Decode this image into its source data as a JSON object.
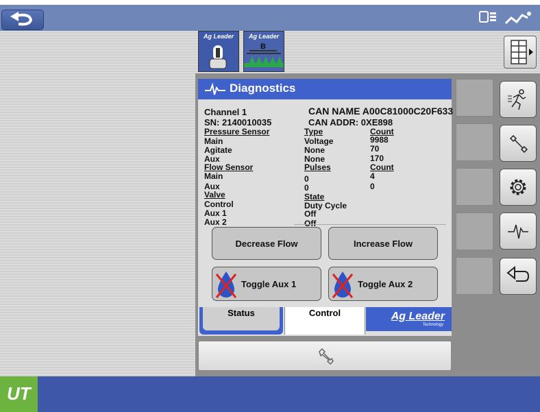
{
  "topbar": {
    "back_icon": "u-turn-back-icon",
    "status_icons": [
      "implement-icon",
      "antenna-icon"
    ]
  },
  "modules": [
    {
      "brand": "Ag Leader",
      "icon": "toggle-switch-icon"
    },
    {
      "brand": "Ag Leader",
      "badge": "B",
      "icon": "sprayer-boom-icon"
    }
  ],
  "menu_button": {
    "icon": "grid-menu-icon"
  },
  "diagnostics": {
    "title": "Diagnostics",
    "channel": "Channel 1",
    "serial": "SN: 2140010035",
    "can_name": "CAN NAME A00C81000C20F633",
    "can_addr": "CAN ADDR:  0XE898",
    "pressure": {
      "header": "Pressure Sensor",
      "type_header": "Type",
      "count_header": "Count",
      "rows": [
        {
          "name": "Main",
          "type": "Voltage",
          "count": "9988"
        },
        {
          "name": "Agitate",
          "type": "None",
          "count": "70"
        },
        {
          "name": "Aux",
          "type": "None",
          "count": "170"
        }
      ]
    },
    "flow": {
      "header": "Flow Sensor",
      "pulses_header": "Pulses",
      "count_header": "Count",
      "rows": [
        {
          "name": "Main",
          "pulses": "0",
          "count": "4"
        },
        {
          "name": "Aux",
          "pulses": "0",
          "count": "0"
        }
      ]
    },
    "valve": {
      "header": "Valve",
      "state_header": "State",
      "rows": [
        {
          "name": "Control",
          "state": "Duty Cycle"
        },
        {
          "name": "Aux 1",
          "state": "Off"
        },
        {
          "name": "Aux 2",
          "state": "Off"
        }
      ]
    },
    "buttons": {
      "decrease_flow": "Decrease Flow",
      "increase_flow": "Increase Flow",
      "toggle_aux1": "Toggle Aux 1",
      "toggle_aux2": "Toggle Aux 2"
    },
    "tabs": {
      "status": "Status",
      "control": "Control"
    },
    "brand": "Ag Leader",
    "brand_sub": "Technology"
  },
  "side_buttons": [
    "running-man-icon",
    "wrench-icon",
    "gear-icon",
    "diagnostics-wave-icon",
    "return-arrow-icon"
  ],
  "bottombar": {
    "logo": "UT"
  },
  "colors": {
    "topbar": "#6f86b8",
    "accent_blue": "#3f61cc",
    "bottombar": "#3f57a8",
    "ut_green": "#6db33f"
  }
}
